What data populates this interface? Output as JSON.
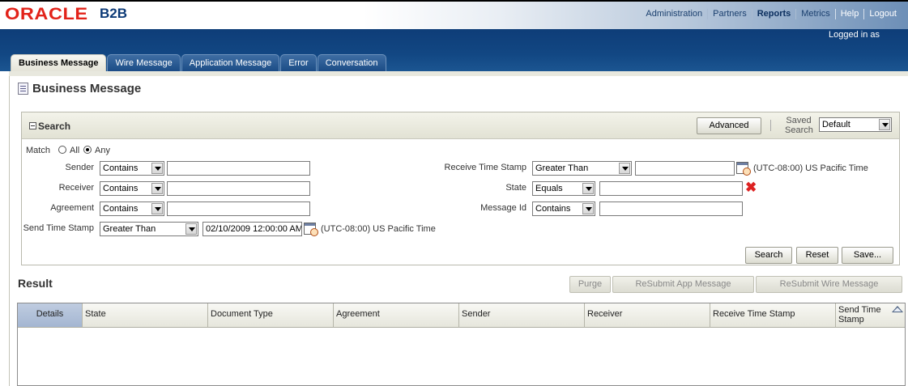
{
  "brand": {
    "oracle": "ORACLE",
    "product": "B2B"
  },
  "global_nav": [
    "Administration",
    "Partners",
    "Reports",
    "Metrics",
    "Help",
    "Logout"
  ],
  "logged_in_text": "Logged in as",
  "tabs": [
    "Business Message",
    "Wire Message",
    "Application Message",
    "Error",
    "Conversation"
  ],
  "page_title": "Business Message",
  "search": {
    "title": "Search",
    "advanced_label": "Advanced",
    "saved_search_label": "Saved Search",
    "saved_search_value": "Default",
    "match_label": "Match",
    "match_all": "All",
    "match_any": "Any",
    "fields_left": [
      {
        "label": "Sender",
        "operator": "Contains",
        "value": ""
      },
      {
        "label": "Receiver",
        "operator": "Contains",
        "value": ""
      },
      {
        "label": "Agreement",
        "operator": "Contains",
        "value": ""
      },
      {
        "label": "Send Time Stamp",
        "operator": "Greater Than",
        "value": "02/10/2009 12:00:00 AM",
        "tz": "(UTC-08:00) US Pacific Time"
      }
    ],
    "fields_right": [
      {
        "label": "Receive Time Stamp",
        "operator": "Greater Than",
        "value": "",
        "tz": "(UTC-08:00) US Pacific Time"
      },
      {
        "label": "State",
        "operator": "Equals",
        "value": ""
      },
      {
        "label": "Message Id",
        "operator": "Contains",
        "value": ""
      }
    ],
    "buttons": {
      "search": "Search",
      "reset": "Reset",
      "save": "Save..."
    }
  },
  "result": {
    "title": "Result",
    "actions": [
      "Purge",
      "ReSubmit App Message",
      "ReSubmit Wire Message"
    ],
    "columns": [
      "Details",
      "State",
      "Document Type",
      "Agreement",
      "Sender",
      "Receiver",
      "Receive Time Stamp",
      "Send Time Stamp"
    ]
  },
  "colors": {
    "oracle_red": "#e2231a",
    "header_blue": "#124783",
    "selected_column": "#a4b6d2"
  }
}
